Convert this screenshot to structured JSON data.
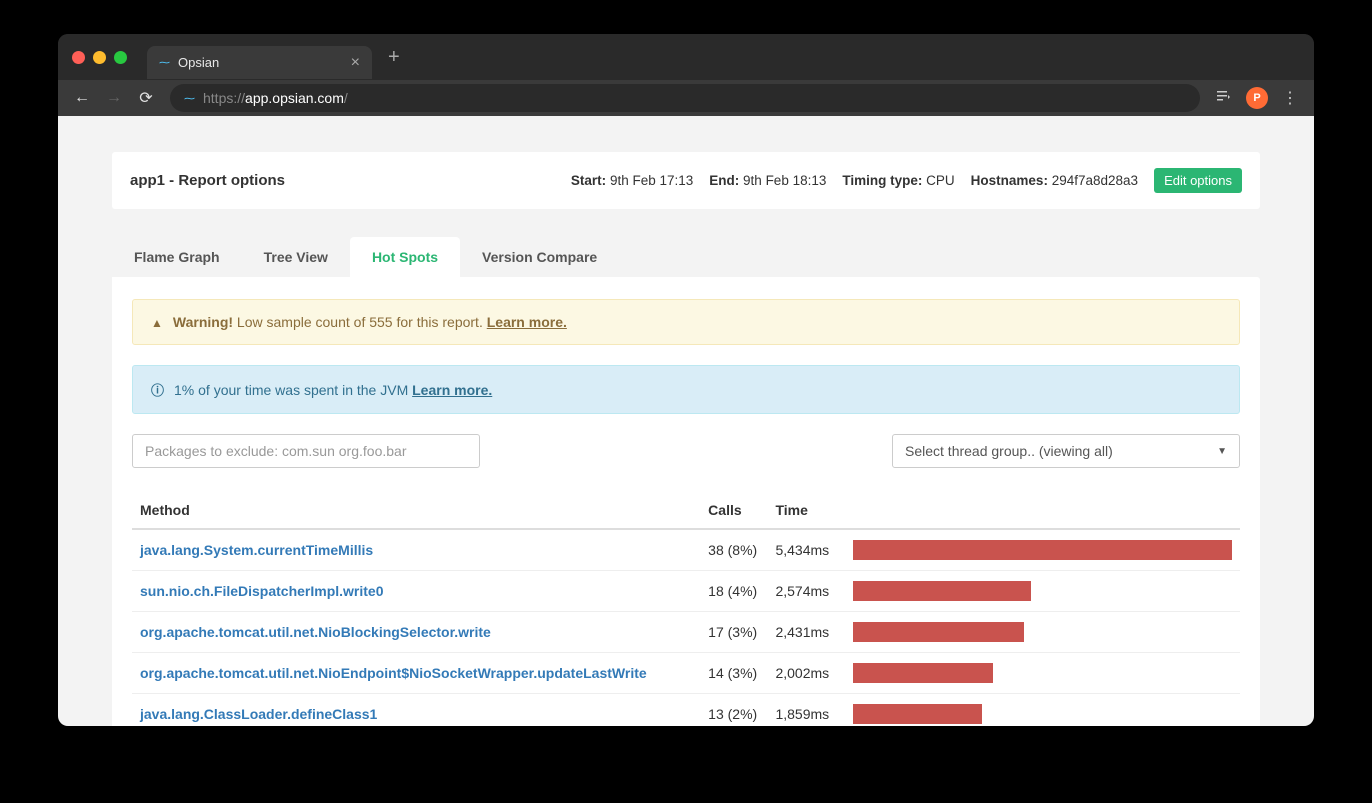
{
  "browser": {
    "tab_title": "Opsian",
    "url_dim_prefix": "https://",
    "url_host": "app.opsian.com",
    "url_dim_suffix": "/",
    "avatar_letter": "P"
  },
  "header": {
    "title": "app1 - Report options",
    "start_label": "Start:",
    "start_value": "9th Feb 17:13",
    "end_label": "End:",
    "end_value": "9th Feb 18:13",
    "timing_label": "Timing type:",
    "timing_value": "CPU",
    "hostnames_label": "Hostnames:",
    "hostnames_value": "294f7a8d28a3",
    "edit_button": "Edit options"
  },
  "tabs": [
    {
      "label": "Flame Graph",
      "active": false
    },
    {
      "label": "Tree View",
      "active": false
    },
    {
      "label": "Hot Spots",
      "active": true
    },
    {
      "label": "Version Compare",
      "active": false
    }
  ],
  "alerts": {
    "warning_strong": "Warning!",
    "warning_text": "Low sample count of 555 for this report.",
    "warning_link": "Learn more.",
    "info_text": "1% of your time was spent in the JVM",
    "info_link": "Learn more."
  },
  "filters": {
    "exclude_placeholder": "Packages to exclude: com.sun org.foo.bar",
    "thread_select_text": "Select thread group.. (viewing all)"
  },
  "table": {
    "headers": {
      "method": "Method",
      "calls": "Calls",
      "time": "Time"
    },
    "rows": [
      {
        "method": "java.lang.System.currentTimeMillis",
        "calls": "38 (8%)",
        "time": "5,434ms",
        "bar_pct": 100
      },
      {
        "method": "sun.nio.ch.FileDispatcherImpl.write0",
        "calls": "18 (4%)",
        "time": "2,574ms",
        "bar_pct": 47
      },
      {
        "method": "org.apache.tomcat.util.net.NioBlockingSelector.write",
        "calls": "17 (3%)",
        "time": "2,431ms",
        "bar_pct": 45
      },
      {
        "method": "org.apache.tomcat.util.net.NioEndpoint$NioSocketWrapper.updateLastWrite",
        "calls": "14 (3%)",
        "time": "2,002ms",
        "bar_pct": 37
      },
      {
        "method": "java.lang.ClassLoader.defineClass1",
        "calls": "13 (2%)",
        "time": "1,859ms",
        "bar_pct": 34
      }
    ]
  }
}
